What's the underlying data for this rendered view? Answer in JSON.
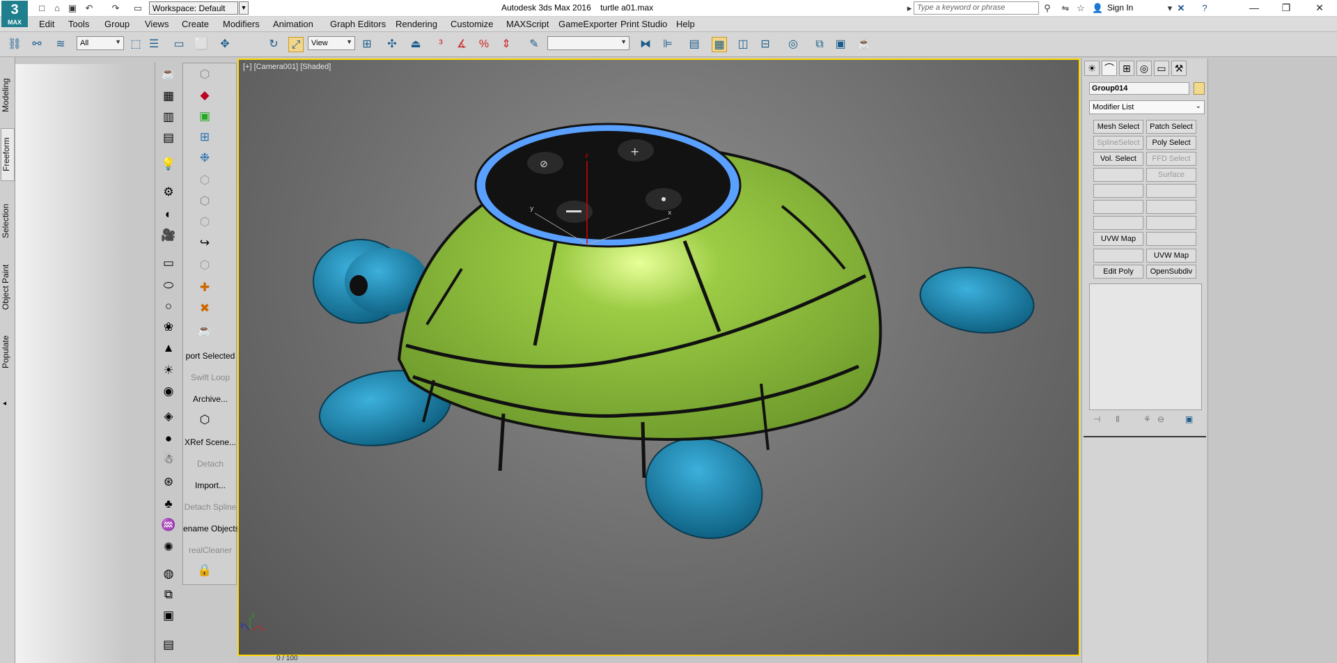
{
  "titlebar": {
    "app_title": "Autodesk 3ds Max 2016",
    "file_name": "turtle a01.max",
    "workspace": "Workspace: Default",
    "search_placeholder": "Type a keyword or phrase",
    "sign_in": "Sign In",
    "logo_text": "MAX"
  },
  "menubar": {
    "items": [
      "Edit",
      "Tools",
      "Group",
      "Views",
      "Create",
      "Modifiers",
      "Animation",
      "Graph Editors",
      "Rendering",
      "Customize",
      "MAXScript",
      "GameExporter",
      "Print Studio",
      "Help"
    ]
  },
  "toolbar": {
    "selection_filter": "All",
    "reference_coord": "View",
    "named_selection": ""
  },
  "left_tabs": [
    "Modeling",
    "Freeform",
    "Selection",
    "Object Paint",
    "Populate"
  ],
  "active_left_tab": "Freeform",
  "scene_explorer_buttons": [
    {
      "label": "port Selected",
      "dim": false
    },
    {
      "label": "Swift Loop",
      "dim": true
    },
    {
      "label": "Archive...",
      "dim": false
    },
    {
      "label": "XRef Scene...",
      "dim": false
    },
    {
      "label": "Detach",
      "dim": true
    },
    {
      "label": "Import...",
      "dim": false
    },
    {
      "label": "Detach Spline",
      "dim": true
    },
    {
      "label": "ename Objects",
      "dim": false
    },
    {
      "label": "realCleaner",
      "dim": true
    }
  ],
  "viewport": {
    "label": "[+] [Camera001] [Shaded]",
    "axis_labels": {
      "x": "x",
      "y": "y",
      "z": "z"
    }
  },
  "command_panel": {
    "object_name": "Group014",
    "modifier_list": "Modifier List",
    "modifier_buttons": [
      [
        "Mesh Select",
        "Patch Select"
      ],
      [
        "SplineSelect",
        "Poly Select"
      ],
      [
        "Vol. Select",
        "FFD Select"
      ],
      [
        "",
        "Surface Select"
      ],
      [
        "",
        ""
      ],
      [
        "",
        ""
      ],
      [
        "",
        ""
      ],
      [
        "UVW Map",
        ""
      ],
      [
        "",
        "UVW Map"
      ],
      [
        "Edit Poly",
        "OpenSubdiv"
      ]
    ],
    "dim_buttons": [
      "SplineSelect",
      "FFD Select",
      "Surface Select"
    ]
  },
  "timeline": {
    "frame": "0 / 100"
  },
  "colors": {
    "viewport_border": "#ffd800",
    "shell_green": "#8fc04a",
    "body_blue": "#1d8fb8",
    "ring_blue": "#5aa0ff"
  }
}
